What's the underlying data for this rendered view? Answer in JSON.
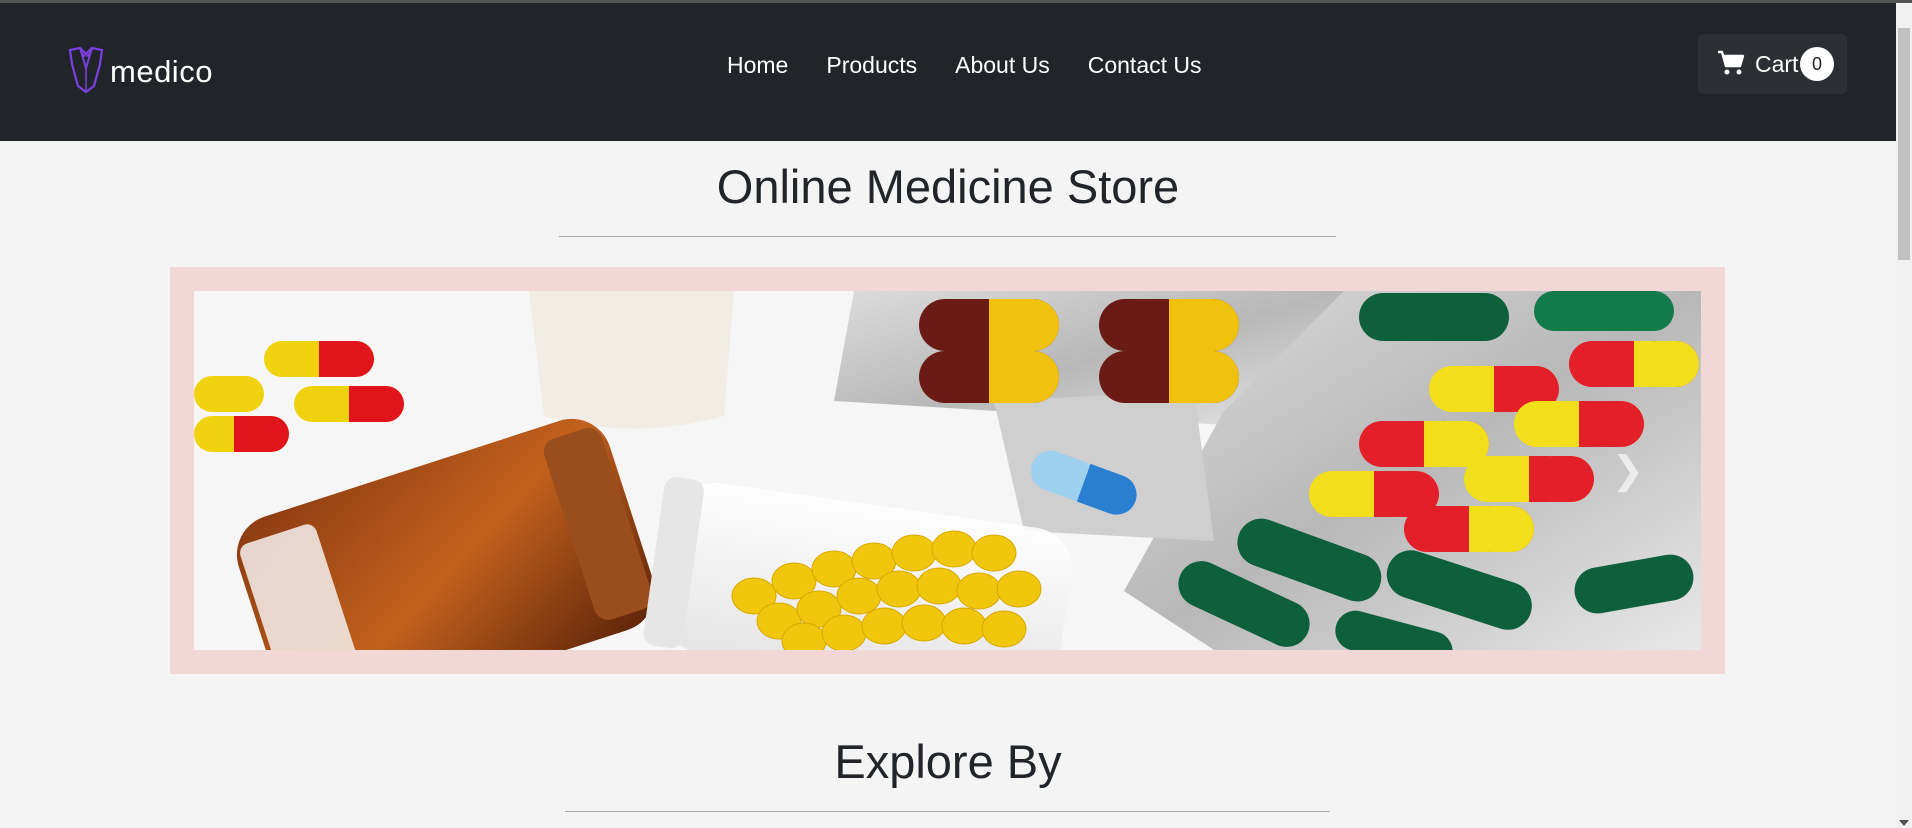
{
  "brand": {
    "name": "medico",
    "logo_icon": "tuxedo-logo-icon",
    "logo_color": "#7b3fe4"
  },
  "nav": {
    "links": [
      {
        "label": "Home"
      },
      {
        "label": "Products"
      },
      {
        "label": "About Us"
      },
      {
        "label": "Contact Us"
      }
    ]
  },
  "cart": {
    "icon": "shopping-cart-icon",
    "label": "Cart",
    "count": "0"
  },
  "hero": {
    "title": "Online Medicine Store",
    "banner_subject": "pills-and-capsules",
    "next_icon": "chevron-right-icon",
    "frame_color": "#f2d7d7"
  },
  "explore": {
    "title": "Explore By"
  },
  "colors": {
    "navbar": "#212529",
    "page_bg": "#f4f4f4",
    "accent": "#7b3fe4"
  }
}
